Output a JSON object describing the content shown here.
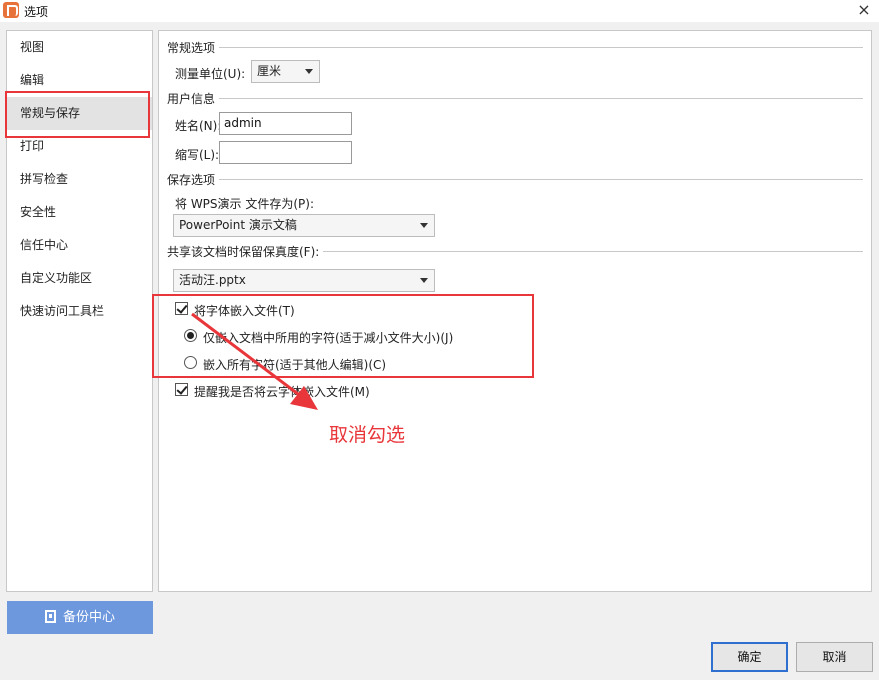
{
  "window": {
    "title": "选项",
    "close_icon": "×"
  },
  "sidebar": {
    "items": [
      {
        "label": "视图"
      },
      {
        "label": "编辑"
      },
      {
        "label": "常规与保存"
      },
      {
        "label": "打印"
      },
      {
        "label": "拼写检查"
      },
      {
        "label": "安全性"
      },
      {
        "label": "信任中心"
      },
      {
        "label": "自定义功能区"
      },
      {
        "label": "快速访问工具栏"
      }
    ],
    "active_index": 2
  },
  "backup": {
    "label": "备份中心"
  },
  "general": {
    "section_title": "常规选项",
    "unit_label": "测量单位(U):",
    "unit_value": "厘米"
  },
  "user": {
    "section_title": "用户信息",
    "name_label": "姓名(N):",
    "name_value": "admin",
    "initials_label": "缩写(L):",
    "initials_value": ""
  },
  "save": {
    "section_title": "保存选项",
    "save_as_label": "将 WPS演示 文件存为(P):",
    "save_as_value": "PowerPoint 演示文稿"
  },
  "share": {
    "section_title": "共享该文档时保留保真度(F):",
    "file_value": "活动汪.pptx",
    "embed_fonts_label": "将字体嵌入文件(T)",
    "embed_fonts_checked": true,
    "embed_used_label": "仅嵌入文档中所用的字符(适于减小文件大小)(J)",
    "embed_used_checked": true,
    "embed_all_label": "嵌入所有字符(适于其他人编辑)(C)",
    "embed_all_checked": false,
    "remind_cloud_label": "提醒我是否将云字体嵌入文件(M)",
    "remind_cloud_checked": true
  },
  "annotation": {
    "text": "取消勾选",
    "color": "#e8363a"
  },
  "footer": {
    "ok_label": "确定",
    "cancel_label": "取消"
  }
}
